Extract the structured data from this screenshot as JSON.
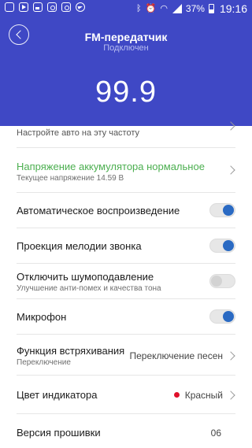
{
  "status_bar": {
    "battery": "37%",
    "time": "19:16",
    "left_icons": [
      "notification-icon",
      "youtube-icon",
      "gallery-icon",
      "instagram-icon",
      "instagram-icon",
      "telegram-icon"
    ],
    "right_icons": [
      "bluetooth-icon",
      "alarm-icon",
      "wifi-icon",
      "signal-icon",
      "battery-icon"
    ]
  },
  "header": {
    "title": "FM-передатчик",
    "subtitle": "Подключен",
    "frequency": "99.9",
    "color": "#3f48c5"
  },
  "settings": {
    "partial_row": {
      "subtitle": "Настройте авто на эту частоту"
    },
    "battery_voltage": {
      "title": "Напряжение аккумулятора нормальное",
      "subtitle": "Текущее напряжение 14.59 В",
      "color": "#4caf50"
    },
    "auto_play": {
      "title": "Автоматическое воспроизведение",
      "on": true
    },
    "ringtone_projection": {
      "title": "Проекция мелодии звонка",
      "on": true
    },
    "noise_reduction": {
      "title": "Отключить шумоподавление",
      "subtitle": "Улучшение анти-помех и качества тона",
      "on": false
    },
    "microphone": {
      "title": "Микрофон",
      "on": true
    },
    "shake_function": {
      "title": "Функция встряхивания",
      "subtitle": "Переключение",
      "value": "Переключение песен"
    },
    "indicator_color": {
      "title": "Цвет индикатора",
      "value": "Красный",
      "dot_color": "#e0102a"
    },
    "firmware": {
      "title": "Версия прошивки",
      "value": "06"
    }
  }
}
